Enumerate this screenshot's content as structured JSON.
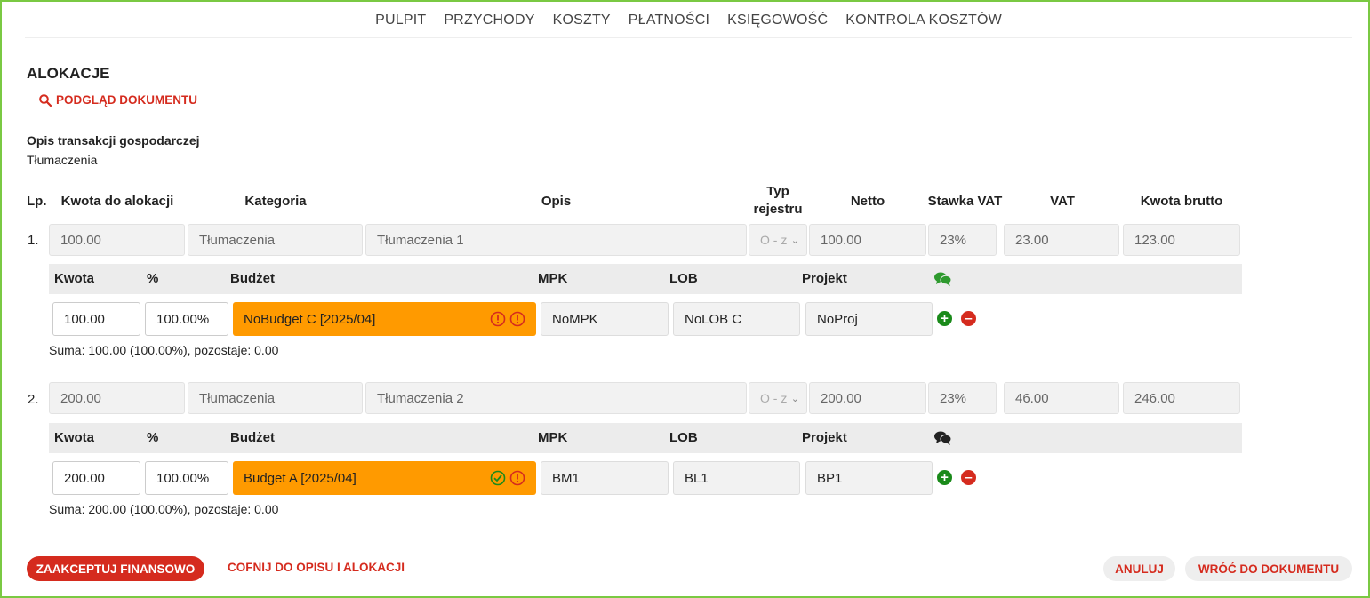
{
  "nav": [
    "PULPIT",
    "PRZYCHODY",
    "KOSZTY",
    "PŁATNOŚCI",
    "KSIĘGOWOŚĆ",
    "KONTROLA KOSZTÓW"
  ],
  "page_title": "ALOKACJE",
  "preview_link": "PODGLĄD DOKUMENTU",
  "opis_label": "Opis transakcji gospodarczej",
  "opis_value": "Tłumaczenia",
  "headers": {
    "lp": "Lp.",
    "kwota": "Kwota do alokacji",
    "kategoria": "Kategoria",
    "opis": "Opis",
    "typ_line1": "Typ",
    "typ_line2": "rejestru",
    "netto": "Netto",
    "stawka": "Stawka VAT",
    "vat": "VAT",
    "brutto": "Kwota brutto"
  },
  "sub_headers": {
    "kwota": "Kwota",
    "pct": "%",
    "budzet": "Budżet",
    "mpk": "MPK",
    "lob": "LOB",
    "projekt": "Projekt"
  },
  "rows": [
    {
      "lp": "1.",
      "kwota": "100.00",
      "kategoria": "Tłumaczenia",
      "opis": "Tłumaczenia 1",
      "typ": "O - z",
      "netto": "100.00",
      "stawka": "23%",
      "vat": "23.00",
      "brutto": "123.00",
      "comment_icon_color": "#2e9a2e",
      "alloc": {
        "kwota": "100.00",
        "pct": "100.00%",
        "budzet": "NoBudget C [2025/04]",
        "budget_status": [
          "warning",
          "warning"
        ],
        "mpk": "NoMPK",
        "lob": "NoLOB C",
        "projekt": "NoProj"
      },
      "suma": "Suma: 100.00 (100.00%), pozostaje: 0.00"
    },
    {
      "lp": "2.",
      "kwota": "200.00",
      "kategoria": "Tłumaczenia",
      "opis": "Tłumaczenia 2",
      "typ": "O - z",
      "netto": "200.00",
      "stawka": "23%",
      "vat": "46.00",
      "brutto": "246.00",
      "comment_icon_color": "#222222",
      "alloc": {
        "kwota": "200.00",
        "pct": "100.00%",
        "budzet": "Budget A [2025/04]",
        "budget_status": [
          "ok",
          "warning"
        ],
        "mpk": "BM1",
        "lob": "BL1",
        "projekt": "BP1"
      },
      "suma": "Suma: 200.00 (100.00%), pozostaje: 0.00"
    }
  ],
  "buttons": {
    "accept": "ZAAKCEPTUJ FINANSOWO",
    "back_to_desc": "COFNIJ DO OPISU I ALOKACJI",
    "cancel": "ANULUJ",
    "return": "WRÓĆ DO DOKUMENTU"
  },
  "colors": {
    "accent": "#d52b1e",
    "budget_bg": "#ff9a00",
    "add": "#1a8a1a",
    "remove": "#d52b1e",
    "frame": "#7ac943"
  }
}
